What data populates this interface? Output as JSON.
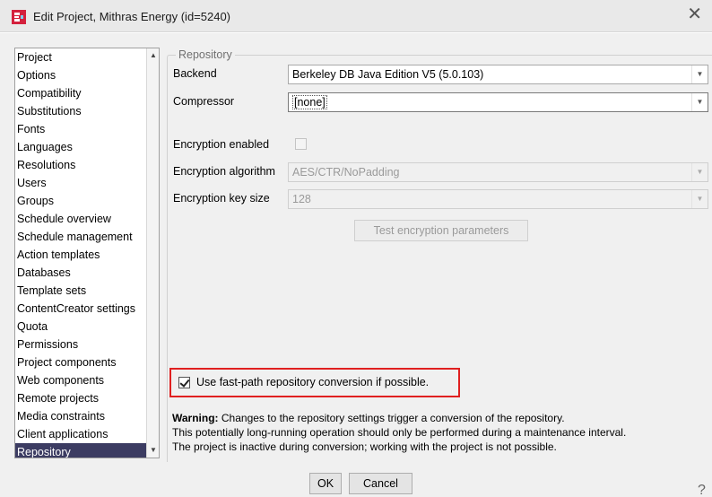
{
  "window": {
    "title": "Edit Project, Mithras Energy (id=5240)",
    "close_glyph": "✕",
    "icon": "app-logo-icon"
  },
  "nav": {
    "items": [
      "Project",
      "Options",
      "Compatibility",
      "Substitutions",
      "Fonts",
      "Languages",
      "Resolutions",
      "Users",
      "Groups",
      "Schedule overview",
      "Schedule management",
      "Action templates",
      "Databases",
      "Template sets",
      "ContentCreator settings",
      "Quota",
      "Permissions",
      "Project components",
      "Web components",
      "Remote projects",
      "Media constraints",
      "Client applications",
      "Repository"
    ],
    "selected": "Repository"
  },
  "repository": {
    "legend": "Repository",
    "backend_label": "Backend",
    "backend_value": "Berkeley DB Java Edition V5 (5.0.103)",
    "compressor_label": "Compressor",
    "compressor_value": "[none]",
    "encryption_enabled_label": "Encryption enabled",
    "encryption_enabled": false,
    "encryption_algorithm_label": "Encryption algorithm",
    "encryption_algorithm_value": "AES/CTR/NoPadding",
    "encryption_key_size_label": "Encryption key size",
    "encryption_key_size_value": "128",
    "test_button": "Test encryption parameters",
    "fastpath_label": "Use fast-path repository conversion if possible.",
    "fastpath_checked": true,
    "warning_bold": "Warning:",
    "warning_line1": " Changes to the repository settings trigger a conversion of the repository.",
    "warning_line2": "This potentially long-running operation should only be performed during a maintenance interval.",
    "warning_line3": "The project is inactive during conversion; working with the project is not possible."
  },
  "footer": {
    "ok": "OK",
    "cancel": "Cancel",
    "help": "?"
  },
  "colors": {
    "selection": "#3c3c62",
    "highlight": "#e02020"
  }
}
